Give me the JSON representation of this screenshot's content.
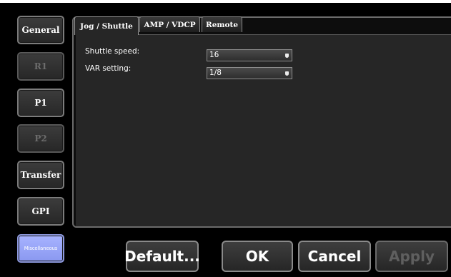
{
  "sidebar": {
    "items": [
      {
        "label": "General",
        "state": "normal"
      },
      {
        "label": "R1",
        "state": "disabled"
      },
      {
        "label": "P1",
        "state": "normal"
      },
      {
        "label": "P2",
        "state": "disabled"
      },
      {
        "label": "Transfer",
        "state": "normal"
      },
      {
        "label": "GPI",
        "state": "normal"
      },
      {
        "label": "Miscellaneous",
        "state": "selected"
      }
    ]
  },
  "tabs": [
    {
      "label": "Jog / Shuttle",
      "active": true
    },
    {
      "label": "AMP / VDCP",
      "active": false
    },
    {
      "label": "Remote",
      "active": false
    }
  ],
  "settings": {
    "shuttle_speed": {
      "label": "Shuttle speed:",
      "value": "16"
    },
    "var_setting": {
      "label": "VAR setting:",
      "value": "1/8"
    }
  },
  "actions": {
    "default": "Default...",
    "ok": "OK",
    "cancel": "Cancel",
    "apply": "Apply"
  },
  "colors": {
    "background": "#000000",
    "panel": "#262626",
    "selected_accent": "#9aa6f8",
    "disabled_text": "#6c6c6c"
  }
}
